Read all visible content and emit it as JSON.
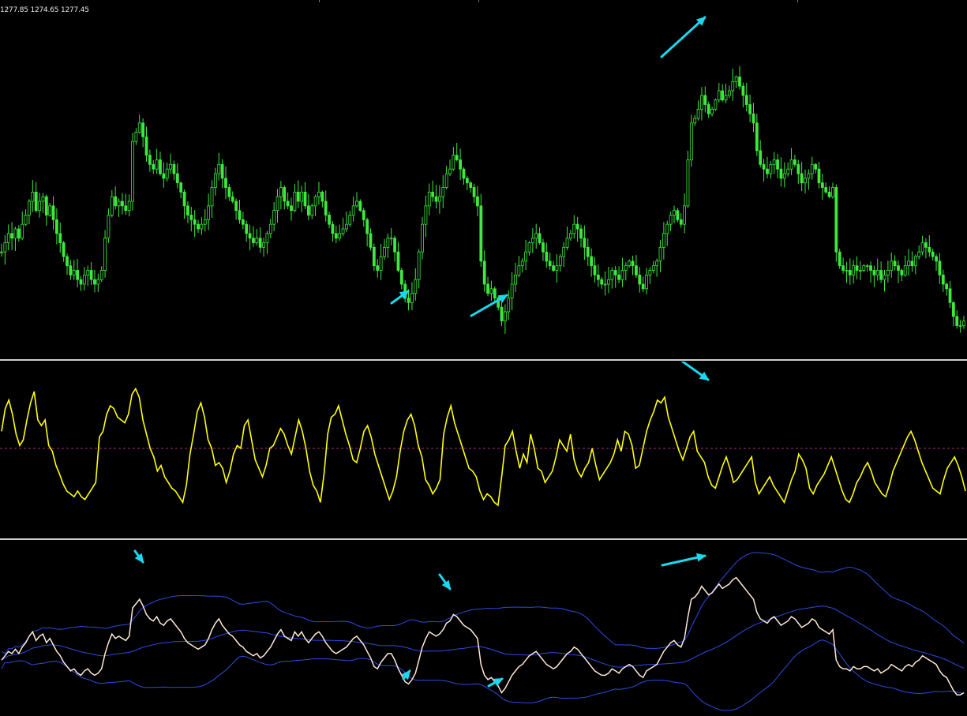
{
  "ohlc_readout": "1277.85 1274.65 1277.45",
  "colors": {
    "background": "#000000",
    "candles": "#3ee83e",
    "oscillator": "#ffff00",
    "oscillator_level": "#a0307a",
    "close_line": "#ffe8d8",
    "bands": "#2e4be0",
    "arrows": "#1ad8ee",
    "separator": "#cfcfcf"
  },
  "chart_data": [
    {
      "type": "candlestick",
      "name": "price",
      "x": "bar",
      "close": [
        1262,
        1264,
        1266,
        1265,
        1267,
        1265,
        1268,
        1270,
        1273,
        1275,
        1271,
        1273,
        1274,
        1270,
        1272,
        1269,
        1266,
        1264,
        1261,
        1259,
        1257,
        1258,
        1256,
        1255,
        1257,
        1258,
        1256,
        1255,
        1256,
        1258,
        1265,
        1270,
        1274,
        1272,
        1273,
        1272,
        1271,
        1273,
        1286,
        1288,
        1290,
        1287,
        1283,
        1281,
        1280,
        1282,
        1279,
        1278,
        1280,
        1281,
        1279,
        1277,
        1275,
        1272,
        1270,
        1269,
        1268,
        1267,
        1268,
        1269,
        1272,
        1276,
        1279,
        1281,
        1278,
        1276,
        1274,
        1273,
        1271,
        1269,
        1268,
        1266,
        1265,
        1264,
        1265,
        1263,
        1264,
        1266,
        1268,
        1271,
        1274,
        1276,
        1273,
        1272,
        1271,
        1275,
        1273,
        1275,
        1272,
        1270,
        1272,
        1274,
        1275,
        1273,
        1270,
        1268,
        1266,
        1265,
        1266,
        1267,
        1268,
        1270,
        1272,
        1273,
        1271,
        1269,
        1266,
        1263,
        1259,
        1258,
        1261,
        1263,
        1265,
        1265,
        1262,
        1258,
        1255,
        1252,
        1251,
        1253,
        1256,
        1262,
        1268,
        1272,
        1275,
        1274,
        1273,
        1274,
        1276,
        1279,
        1280,
        1283,
        1282,
        1280,
        1278,
        1277,
        1276,
        1274,
        1272,
        1260,
        1255,
        1253,
        1254,
        1252,
        1250,
        1247,
        1249,
        1252,
        1255,
        1257,
        1259,
        1260,
        1262,
        1264,
        1265,
        1266,
        1264,
        1262,
        1260,
        1259,
        1258,
        1259,
        1261,
        1263,
        1265,
        1266,
        1268,
        1267,
        1265,
        1263,
        1261,
        1259,
        1257,
        1256,
        1255,
        1255,
        1256,
        1258,
        1257,
        1256,
        1258,
        1259,
        1260,
        1259,
        1257,
        1255,
        1254,
        1257,
        1258,
        1259,
        1260,
        1263,
        1266,
        1268,
        1270,
        1271,
        1269,
        1268,
        1272,
        1282,
        1290,
        1291,
        1293,
        1296,
        1294,
        1292,
        1293,
        1295,
        1297,
        1295,
        1296,
        1297,
        1299,
        1300,
        1298,
        1296,
        1294,
        1292,
        1290,
        1284,
        1281,
        1280,
        1279,
        1281,
        1282,
        1280,
        1278,
        1279,
        1280,
        1282,
        1281,
        1279,
        1277,
        1278,
        1279,
        1281,
        1280,
        1277,
        1276,
        1275,
        1274,
        1276,
        1262,
        1259,
        1258,
        1258,
        1257,
        1259,
        1258,
        1258,
        1259,
        1259,
        1258,
        1257,
        1258,
        1256,
        1257,
        1258,
        1260,
        1259,
        1258,
        1257,
        1259,
        1260,
        1259,
        1261,
        1262,
        1264,
        1263,
        1262,
        1261,
        1260,
        1257,
        1255,
        1254,
        1251,
        1248,
        1246,
        1246,
        1247
      ],
      "notes": "approximate; price axis scale not shown, values estimated in index units"
    },
    {
      "type": "line",
      "name": "oscillator",
      "x": "bar",
      "values": [
        62,
        78,
        84,
        74,
        60,
        52,
        56,
        70,
        82,
        90,
        70,
        66,
        70,
        52,
        48,
        38,
        32,
        25,
        20,
        18,
        16,
        20,
        16,
        14,
        18,
        22,
        26,
        58,
        62,
        74,
        80,
        78,
        72,
        70,
        68,
        74,
        88,
        92,
        86,
        70,
        60,
        50,
        44,
        34,
        38,
        30,
        26,
        22,
        20,
        16,
        12,
        24,
        46,
        60,
        76,
        82,
        72,
        56,
        50,
        38,
        40,
        36,
        26,
        34,
        46,
        52,
        50,
        66,
        70,
        56,
        42,
        36,
        30,
        38,
        50,
        52,
        58,
        64,
        60,
        52,
        46,
        58,
        70,
        62,
        50,
        34,
        24,
        20,
        12,
        32,
        60,
        72,
        74,
        80,
        70,
        60,
        52,
        42,
        40,
        50,
        62,
        66,
        58,
        46,
        38,
        30,
        22,
        14,
        20,
        30,
        48,
        62,
        70,
        74,
        66,
        52,
        44,
        28,
        24,
        18,
        22,
        28,
        60,
        72,
        80,
        68,
        60,
        52,
        44,
        36,
        34,
        30,
        20,
        14,
        18,
        16,
        12,
        10,
        30,
        52,
        56,
        62,
        48,
        36,
        46,
        40,
        60,
        50,
        36,
        34,
        26,
        30,
        34,
        44,
        56,
        52,
        48,
        60,
        42,
        34,
        30,
        36,
        40,
        50,
        38,
        28,
        32,
        36,
        40,
        46,
        56,
        48,
        62,
        60,
        52,
        36,
        38,
        50,
        62,
        70,
        76,
        84,
        82,
        86,
        72,
        64,
        56,
        48,
        42,
        50,
        58,
        62,
        48,
        44,
        40,
        30,
        24,
        22,
        30,
        38,
        44,
        36,
        26,
        28,
        32,
        36,
        40,
        44,
        26,
        18,
        22,
        26,
        30,
        24,
        20,
        16,
        12,
        20,
        28,
        34,
        46,
        42,
        36,
        22,
        18,
        24,
        28,
        32,
        38,
        44,
        36,
        28,
        20,
        14,
        12,
        18,
        26,
        30,
        36,
        40,
        34,
        26,
        22,
        18,
        16,
        24,
        34,
        40,
        46,
        52,
        58,
        62,
        56,
        48,
        40,
        34,
        28,
        22,
        20,
        18,
        28,
        36,
        40,
        44,
        38,
        30,
        20
      ],
      "level": 50
    },
    {
      "type": "line",
      "name": "bands",
      "x": "bar",
      "close": [
        1262,
        1264,
        1266,
        1265,
        1267,
        1265,
        1268,
        1270,
        1273,
        1275,
        1271,
        1273,
        1274,
        1270,
        1272,
        1269,
        1266,
        1264,
        1261,
        1259,
        1257,
        1258,
        1256,
        1255,
        1257,
        1258,
        1256,
        1255,
        1256,
        1258,
        1265,
        1270,
        1274,
        1272,
        1273,
        1272,
        1271,
        1273,
        1286,
        1288,
        1290,
        1287,
        1283,
        1281,
        1280,
        1282,
        1279,
        1278,
        1280,
        1281,
        1279,
        1277,
        1275,
        1272,
        1270,
        1269,
        1268,
        1267,
        1268,
        1269,
        1272,
        1276,
        1279,
        1281,
        1278,
        1276,
        1274,
        1273,
        1271,
        1269,
        1268,
        1266,
        1265,
        1264,
        1265,
        1263,
        1264,
        1266,
        1268,
        1271,
        1274,
        1276,
        1273,
        1272,
        1271,
        1275,
        1273,
        1275,
        1272,
        1270,
        1272,
        1274,
        1275,
        1273,
        1270,
        1268,
        1266,
        1265,
        1266,
        1267,
        1268,
        1270,
        1272,
        1273,
        1271,
        1269,
        1266,
        1263,
        1259,
        1258,
        1261,
        1263,
        1265,
        1265,
        1262,
        1258,
        1255,
        1252,
        1251,
        1253,
        1256,
        1262,
        1268,
        1272,
        1275,
        1274,
        1273,
        1274,
        1276,
        1279,
        1280,
        1283,
        1282,
        1280,
        1278,
        1277,
        1276,
        1274,
        1272,
        1260,
        1255,
        1253,
        1254,
        1252,
        1250,
        1247,
        1249,
        1252,
        1255,
        1257,
        1259,
        1260,
        1262,
        1264,
        1265,
        1266,
        1264,
        1262,
        1260,
        1259,
        1258,
        1259,
        1261,
        1263,
        1265,
        1266,
        1268,
        1267,
        1265,
        1263,
        1261,
        1259,
        1257,
        1256,
        1255,
        1255,
        1256,
        1258,
        1257,
        1256,
        1258,
        1259,
        1260,
        1259,
        1257,
        1255,
        1254,
        1257,
        1258,
        1259,
        1260,
        1263,
        1266,
        1268,
        1270,
        1271,
        1269,
        1268,
        1272,
        1282,
        1290,
        1291,
        1293,
        1296,
        1294,
        1292,
        1293,
        1295,
        1297,
        1295,
        1296,
        1297,
        1299,
        1300,
        1298,
        1296,
        1294,
        1292,
        1290,
        1284,
        1281,
        1280,
        1279,
        1281,
        1282,
        1280,
        1278,
        1279,
        1280,
        1282,
        1281,
        1279,
        1277,
        1278,
        1279,
        1281,
        1280,
        1277,
        1276,
        1275,
        1274,
        1276,
        1262,
        1259,
        1258,
        1258,
        1257,
        1259,
        1258,
        1258,
        1259,
        1259,
        1258,
        1257,
        1258,
        1256,
        1257,
        1258,
        1260,
        1259,
        1258,
        1257,
        1259,
        1260,
        1259,
        1261,
        1262,
        1264,
        1263,
        1262,
        1261,
        1260,
        1257,
        1255,
        1254,
        1251,
        1248,
        1246,
        1246,
        1247
      ],
      "period": 40,
      "deviations": 2
    }
  ],
  "annotations": [
    {
      "pane": "price",
      "direction": "up-right",
      "note": "divergence arrow"
    },
    {
      "pane": "price",
      "direction": "up-right",
      "note": "divergence arrow"
    },
    {
      "pane": "price",
      "direction": "up-right",
      "note": "divergence arrow"
    },
    {
      "pane": "oscillator",
      "direction": "down-right",
      "note": "divergence arrow"
    },
    {
      "pane": "bands",
      "direction": "down-right",
      "note": "band touch arrow"
    },
    {
      "pane": "bands",
      "direction": "down-right",
      "note": "band touch arrow"
    },
    {
      "pane": "bands",
      "direction": "up-right",
      "note": "band touch arrow"
    },
    {
      "pane": "bands",
      "direction": "up-right",
      "note": "band touch arrow"
    },
    {
      "pane": "bands",
      "direction": "up-right",
      "note": "band touch arrow"
    }
  ]
}
